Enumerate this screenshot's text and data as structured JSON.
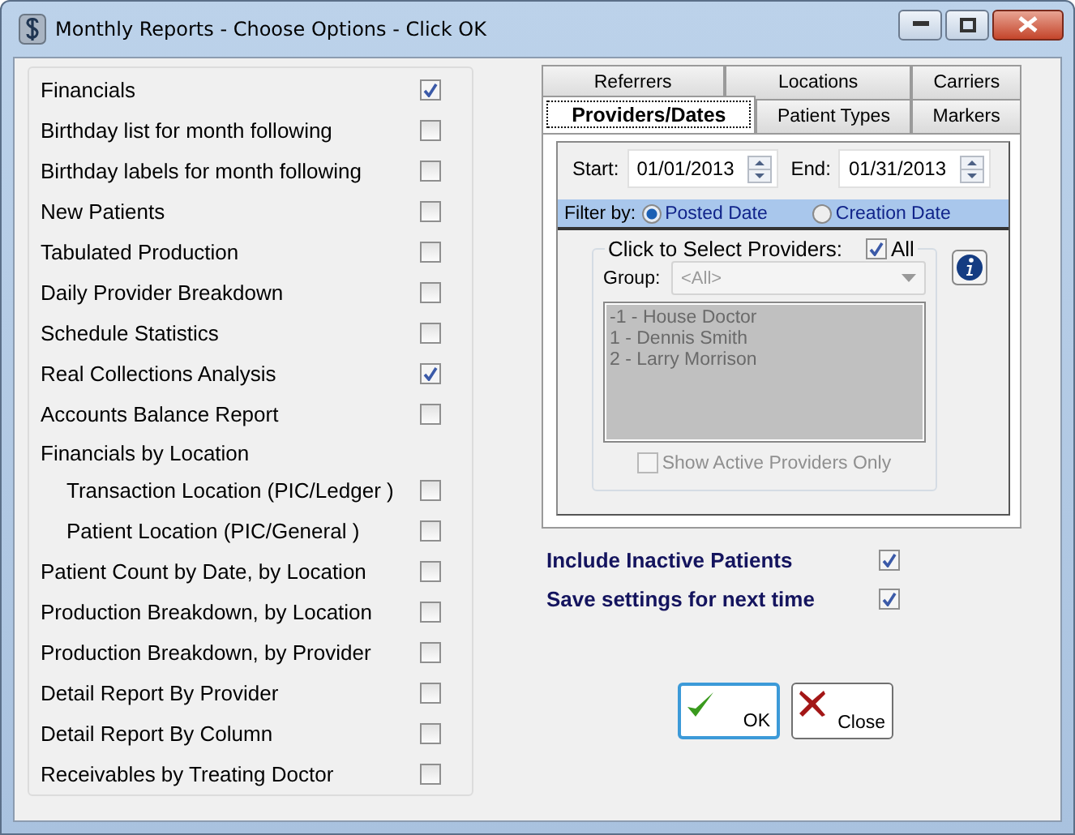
{
  "window": {
    "title": "Monthly Reports - Choose Options - Click OK"
  },
  "reports": [
    {
      "kind": "option",
      "label": "Financials",
      "checked": true
    },
    {
      "kind": "option",
      "label": "Birthday list for month following",
      "checked": false
    },
    {
      "kind": "option",
      "label": "Birthday labels for month following",
      "checked": false
    },
    {
      "kind": "option",
      "label": "New Patients",
      "checked": false
    },
    {
      "kind": "option",
      "label": "Tabulated Production",
      "checked": false
    },
    {
      "kind": "option",
      "label": "Daily Provider Breakdown",
      "checked": false
    },
    {
      "kind": "option",
      "label": "Schedule Statistics",
      "checked": false
    },
    {
      "kind": "option",
      "label": "Real Collections Analysis",
      "checked": true
    },
    {
      "kind": "option",
      "label": "Accounts Balance Report",
      "checked": false
    },
    {
      "kind": "heading",
      "label": "Financials by Location",
      "children": [
        {
          "kind": "option",
          "label": "Transaction Location (PIC/Ledger )",
          "checked": false
        },
        {
          "kind": "option",
          "label": "Patient Location (PIC/General )",
          "checked": false
        }
      ]
    },
    {
      "kind": "option",
      "label": "Patient Count by Date, by Location",
      "checked": false
    },
    {
      "kind": "option",
      "label": "Production Breakdown, by Location",
      "checked": false
    },
    {
      "kind": "option",
      "label": "Production Breakdown, by Provider",
      "checked": false
    },
    {
      "kind": "option",
      "label": "Detail Report By Provider",
      "checked": false
    },
    {
      "kind": "option",
      "label": "Detail Report By Column",
      "checked": false
    },
    {
      "kind": "option",
      "label": "Receivables by Treating Doctor",
      "checked": false
    }
  ],
  "tab_rows": [
    [
      {
        "label": "Referrers",
        "selected": false
      },
      {
        "label": "Locations",
        "selected": false
      },
      {
        "label": "Carriers",
        "selected": false
      }
    ],
    [
      {
        "label": "Providers/Dates",
        "selected": true
      },
      {
        "label": "Patient Types",
        "selected": false
      },
      {
        "label": "Markers",
        "selected": false
      }
    ]
  ],
  "dates": {
    "start_label": "Start:",
    "start": "01/01/2013",
    "end_label": "End:",
    "end": "01/31/2013"
  },
  "filter": {
    "label": "Filter by:",
    "options": [
      {
        "label": "Posted Date",
        "selected": true
      },
      {
        "label": "Creation Date",
        "selected": false
      }
    ]
  },
  "providers": {
    "title": "Click to Select Providers:",
    "all_label": "All",
    "all_checked": true,
    "group_label": "Group:",
    "group_value": "<All>",
    "items": [
      "-1 - House Doctor",
      "1 - Dennis Smith",
      "2 - Larry Morrison"
    ],
    "active_only_label": "Show Active Providers Only",
    "active_only_checked": false
  },
  "settings": [
    {
      "label": "Include Inactive Patients",
      "checked": true
    },
    {
      "label": "Save settings for next time",
      "checked": true
    }
  ],
  "buttons": [
    {
      "kind": "ok",
      "label": "OK"
    },
    {
      "kind": "close",
      "label": "Close"
    }
  ]
}
